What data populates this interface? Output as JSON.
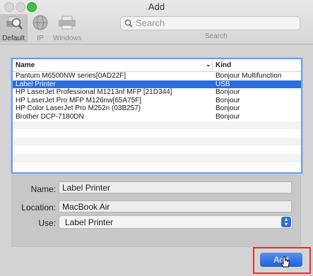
{
  "window": {
    "title": "Add"
  },
  "toolbar": {
    "default_label": "Default",
    "ip_label": "IP",
    "windows_label": "Windows",
    "search_placeholder": "Search",
    "search_label": "Search"
  },
  "printer_list": {
    "col_name": "Name",
    "col_kind": "Kind",
    "sort_indicator": "⌄",
    "rows": [
      {
        "name": "Pantum M6500NW series[0AD22F]",
        "kind": "Bonjour Multifunction"
      },
      {
        "name": "Label Printer",
        "kind": "USB"
      },
      {
        "name": "HP LaserJet Professional M1213nf MFP [21D344]",
        "kind": "Bonjour"
      },
      {
        "name": "HP LaserJet Pro MFP M126nw[65A75F]",
        "kind": "Bonjour"
      },
      {
        "name": "HP Color LaserJet Pro M252n (03B257)",
        "kind": "Bonjour"
      },
      {
        "name": "Brother DCP-7180DN",
        "kind": "Bonjour"
      }
    ],
    "selected_index": 1
  },
  "form": {
    "name_label": "Name:",
    "name_value": "Label Printer",
    "location_label": "Location:",
    "location_value": "MacBook Air",
    "use_label": "Use:",
    "use_value": "Label Printer"
  },
  "actions": {
    "add_label": "Add"
  },
  "colors": {
    "accent": "#2a6ee0",
    "highlight": "#e0322c"
  }
}
